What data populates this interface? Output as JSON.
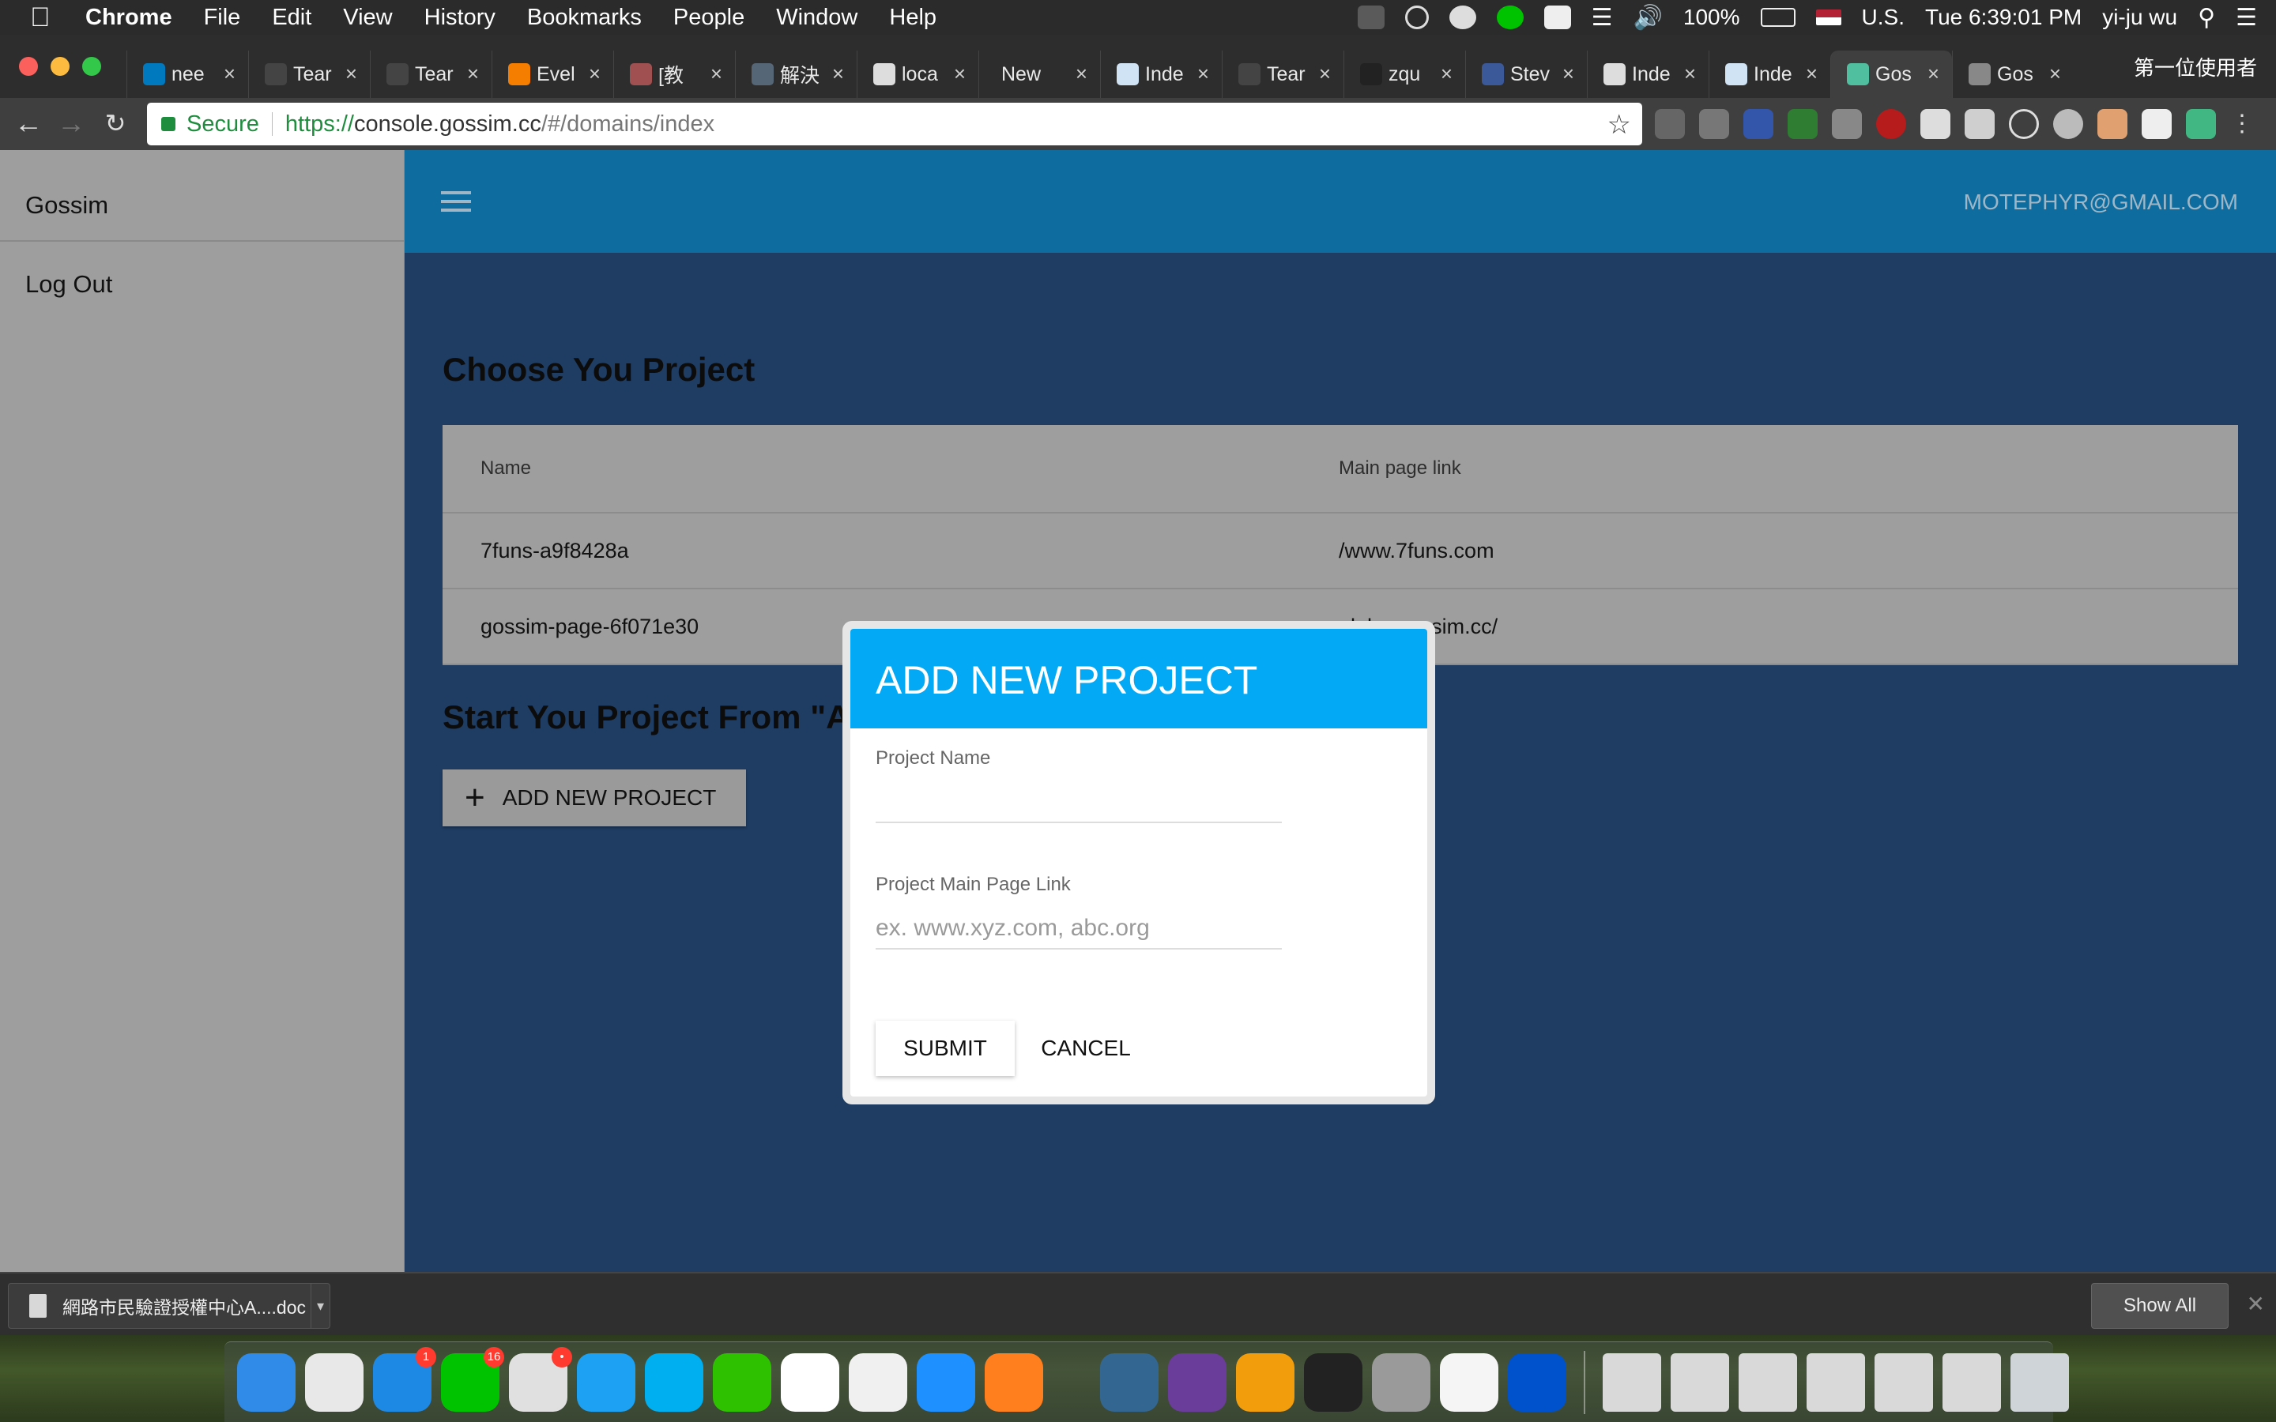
{
  "menubar": {
    "app_name": "Chrome",
    "menus": [
      "File",
      "Edit",
      "View",
      "History",
      "Bookmarks",
      "People",
      "Window",
      "Help"
    ],
    "battery": "100%",
    "input_source": "U.S.",
    "clock": "Tue 6:39:01 PM",
    "user": "yi-ju wu"
  },
  "browser": {
    "tabs": [
      {
        "title": "nee",
        "icon": "trello-icon",
        "color": "#0079bf"
      },
      {
        "title": "Tear",
        "icon": "tearsheet-icon",
        "color": "#444444"
      },
      {
        "title": "Tear",
        "icon": "tearsheet-icon",
        "color": "#444444"
      },
      {
        "title": "Evel",
        "icon": "blogger-icon",
        "color": "#f57d00"
      },
      {
        "title": "[教",
        "icon": "page-icon",
        "color": "#a05050"
      },
      {
        "title": "解決",
        "icon": "page-icon",
        "color": "#556677"
      },
      {
        "title": "loca",
        "icon": "page-icon",
        "color": "#dddddd"
      },
      {
        "title": "New Ta",
        "icon": "",
        "color": "transparent"
      },
      {
        "title": "Inde",
        "icon": "page-icon",
        "color": "#cfe3f5"
      },
      {
        "title": "Tear",
        "icon": "tearsheet-icon",
        "color": "#444444"
      },
      {
        "title": "zqu",
        "icon": "github-icon",
        "color": "#222222"
      },
      {
        "title": "Stev",
        "icon": "facebook-icon",
        "color": "#3b5998"
      },
      {
        "title": "Inde",
        "icon": "elephant-icon",
        "color": "#dddddd"
      },
      {
        "title": "Inde",
        "icon": "page-icon",
        "color": "#cfe3f5"
      },
      {
        "title": "Gos",
        "icon": "gossim-icon",
        "color": "#4fbf9f",
        "active": true
      },
      {
        "title": "Gos",
        "icon": "document-icon",
        "color": "#888888"
      }
    ],
    "profile": "第一位使用者",
    "security_label": "Secure",
    "url_protocol": "https://",
    "url_host": "console.gossim.cc",
    "url_path": "/#/domains/index"
  },
  "sidebar": {
    "brand": "Gossim",
    "logout": "Log Out"
  },
  "appbar": {
    "user_email": "MOTEPHYR@GMAIL.COM"
  },
  "main": {
    "heading": "Choose You Project",
    "table_headers": [
      "Name",
      "Main page link"
    ],
    "projects": [
      {
        "name": "7funs-a9f8428a",
        "link": "/www.7funs.com"
      },
      {
        "name": "gossim-page-6f071e30",
        "link": "alpha.gossim.cc/"
      }
    ],
    "second_heading": "Start You Project From \"A",
    "add_button": "ADD NEW PROJECT"
  },
  "modal": {
    "title": "ADD NEW PROJECT",
    "field_name_label": "Project Name",
    "field_name_value": "",
    "field_link_label": "Project Main Page Link",
    "field_link_placeholder": "ex. www.xyz.com, abc.org",
    "submit": "SUBMIT",
    "cancel": "CANCEL"
  },
  "downloads": {
    "file": "網路市民驗證授權中心A....doc",
    "show_all": "Show All"
  },
  "dock": {
    "apps": [
      {
        "name": "finder-icon",
        "color": "#2f8ae8"
      },
      {
        "name": "chrome-icon",
        "color": "#e8e8e8"
      },
      {
        "name": "messenger-icon",
        "color": "#1e88e5",
        "badge": "1"
      },
      {
        "name": "line-icon",
        "color": "#00c300",
        "badge": "16"
      },
      {
        "name": "slack-icon",
        "color": "#e0e0e0",
        "badge": "•"
      },
      {
        "name": "twitter-icon",
        "color": "#1da1f2"
      },
      {
        "name": "skype-icon",
        "color": "#00aff0"
      },
      {
        "name": "wechat-icon",
        "color": "#2dc100"
      },
      {
        "name": "calendar-icon",
        "color": "#ffffff"
      },
      {
        "name": "emoji-icon",
        "color": "#f0f0f0"
      },
      {
        "name": "safari-icon",
        "color": "#1e90ff"
      },
      {
        "name": "firefox-icon",
        "color": "#ff7f1f"
      },
      {
        "name": "postgres-icon",
        "color": "#336791"
      },
      {
        "name": "pencil-icon",
        "color": "#6a3d9a"
      },
      {
        "name": "sublime-icon",
        "color": "#f29d0c"
      },
      {
        "name": "terminal-icon",
        "color": "#222222"
      },
      {
        "name": "tableplus-icon",
        "color": "#9a9a9a"
      },
      {
        "name": "textedit-icon",
        "color": "#f5f5f5"
      },
      {
        "name": "sourcetree-icon",
        "color": "#0052cc"
      }
    ],
    "docs": [
      "doc-file-icon",
      "window-thumb-icon",
      "window-thumb-icon",
      "window-thumb-icon",
      "window-thumb-icon",
      "window-thumb-icon",
      "trash-icon"
    ]
  }
}
